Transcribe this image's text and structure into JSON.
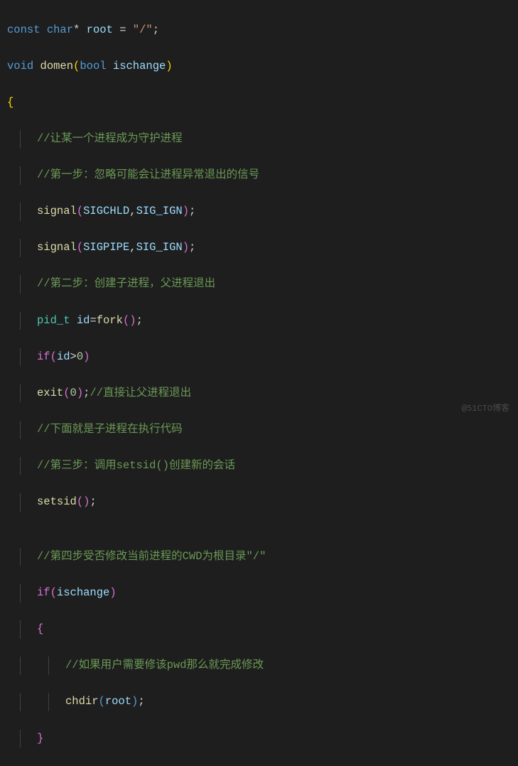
{
  "code": {
    "l1_kw1": "const",
    "l1_kw2": "char",
    "l1_op": "*",
    "l1_var": "root",
    "l1_eq": " = ",
    "l1_str": "\"/\"",
    "l1_semi": ";",
    "l2_kw": "void",
    "l2_fn": "domen",
    "l2_lp": "(",
    "l2_type": "bool",
    "l2_sp": " ",
    "l2_var": "ischange",
    "l2_rp": ")",
    "l3_brace": "{",
    "l4_comment": "//让某一个进程成为守护进程",
    "l5_comment": "//第一步：忽略可能会让进程异常退出的信号",
    "l6_fn": "signal",
    "l6_lp": "(",
    "l6_a1": "SIGCHLD",
    "l6_comma": ",",
    "l6_a2": "SIG_IGN",
    "l6_rp": ")",
    "l6_semi": ";",
    "l7_fn": "signal",
    "l7_lp": "(",
    "l7_a1": "SIGPIPE",
    "l7_comma": ",",
    "l7_a2": "SIG_IGN",
    "l7_rp": ")",
    "l7_semi": ";",
    "l8_comment": "//第二步：创建子进程，父进程退出",
    "l9_type": "pid_t",
    "l9_sp": " ",
    "l9_var": "id",
    "l9_eq": "=",
    "l9_fn": "fork",
    "l9_lp": "(",
    "l9_rp": ")",
    "l9_semi": ";",
    "l10_kw": "if",
    "l10_lp": "(",
    "l10_var": "id",
    "l10_op": ">",
    "l10_num": "0",
    "l10_rp": ")",
    "l11_fn": "exit",
    "l11_lp": "(",
    "l11_num": "0",
    "l11_rp": ")",
    "l11_semi": ";",
    "l11_comment": "//直接让父进程退出",
    "l12_comment": "//下面就是子进程在执行代码",
    "l13_comment": "//第三步：调用setsid()创建新的会话",
    "l14_fn": "setsid",
    "l14_lp": "(",
    "l14_rp": ")",
    "l14_semi": ";",
    "l15_blank": "",
    "l16_comment": "//第四步受否修改当前进程的CWD为根目录\"/\"",
    "l17_kw": "if",
    "l17_lp": "(",
    "l17_var": "ischange",
    "l17_rp": ")",
    "l18_brace": "{",
    "l19_comment": "//如果用户需要修该pwd那么就完成修改",
    "l20_fn": "chdir",
    "l20_lp": "(",
    "l20_var": "root",
    "l20_rp": ")",
    "l20_semi": ";",
    "l21_brace": "}"
  },
  "watermark": "@51CTO博客"
}
